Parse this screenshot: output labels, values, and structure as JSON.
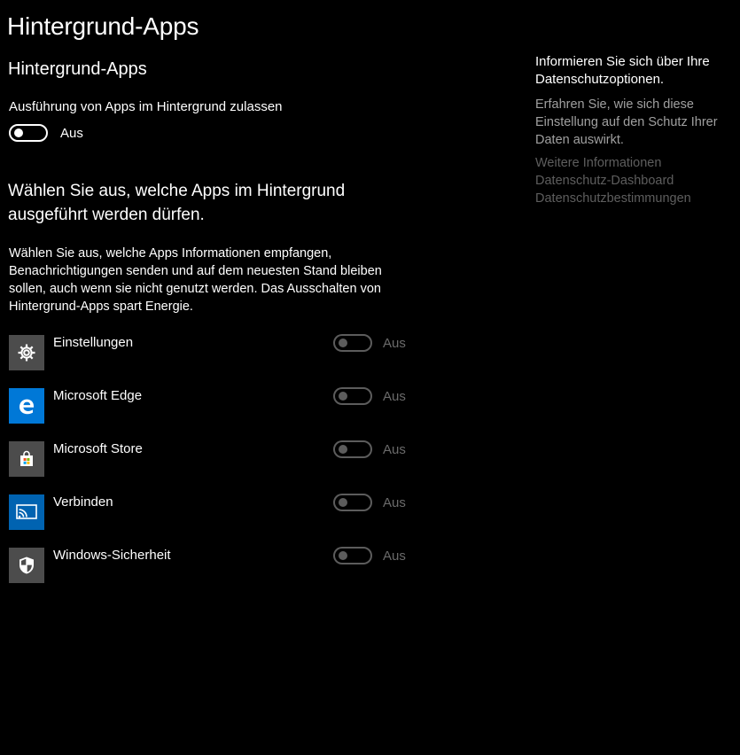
{
  "page": {
    "title": "Hintergrund-Apps"
  },
  "section": {
    "title": "Hintergrund-Apps"
  },
  "master": {
    "label": "Ausführung von Apps im Hintergrund zulassen",
    "state": "Aus"
  },
  "apps_section": {
    "heading": "Wählen Sie aus, welche Apps im Hintergrund ausgeführt werden dürfen.",
    "description": "Wählen Sie aus, welche Apps Informationen empfangen, Benachrichtigungen senden und auf dem neuesten Stand bleiben sollen, auch wenn sie nicht genutzt werden. Das Ausschalten von Hintergrund-Apps spart Energie."
  },
  "apps": [
    {
      "name": "Einstellungen",
      "state": "Aus",
      "icon": "gear-icon",
      "tile_color": "#4c4c4c"
    },
    {
      "name": "Microsoft Edge",
      "state": "Aus",
      "icon": "edge-icon",
      "tile_color": "#0078d7"
    },
    {
      "name": "Microsoft Store",
      "state": "Aus",
      "icon": "store-icon",
      "tile_color": "#4c4c4c"
    },
    {
      "name": "Verbinden",
      "state": "Aus",
      "icon": "connect-icon",
      "tile_color": "#0063b1"
    },
    {
      "name": "Windows-Sicherheit",
      "state": "Aus",
      "icon": "shield-icon",
      "tile_color": "#4c4c4c"
    }
  ],
  "sidebar": {
    "title": "Informieren Sie sich über Ihre Datenschutzoptionen.",
    "text": "Erfahren Sie, wie sich diese Einstellung auf den Schutz Ihrer Daten auswirkt.",
    "links": [
      "Weitere Informationen",
      "Datenschutz-Dashboard",
      "Datenschutzbestimmungen"
    ]
  }
}
